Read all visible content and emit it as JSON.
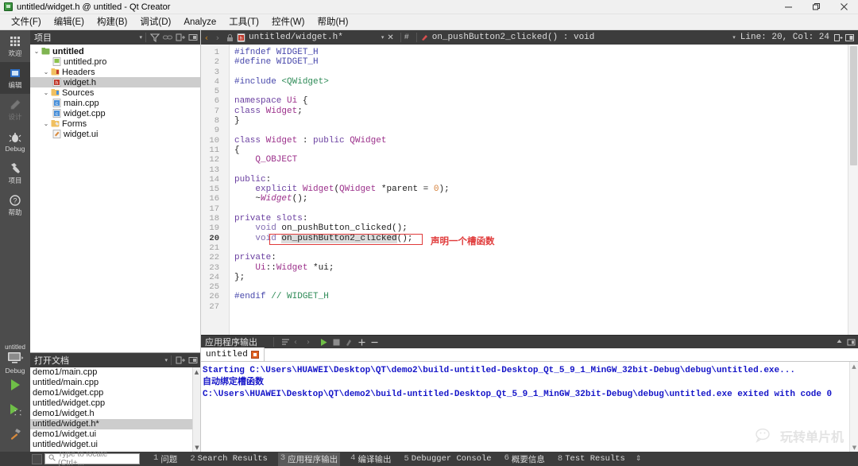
{
  "window": {
    "title": "untitled/widget.h @ untitled - Qt Creator",
    "app_icon": "qt-creator-icon",
    "minimize": "minimize-icon",
    "maximize": "restore-icon",
    "close": "close-icon"
  },
  "menubar": {
    "items": [
      {
        "label": "文件(F)"
      },
      {
        "label": "编辑(E)"
      },
      {
        "label": "构建(B)"
      },
      {
        "label": "调试(D)"
      },
      {
        "label": "Analyze"
      },
      {
        "label": "工具(T)"
      },
      {
        "label": "控件(W)"
      },
      {
        "label": "帮助(H)"
      }
    ]
  },
  "modebar": {
    "items": [
      {
        "label": "欢迎",
        "icon": "grid-icon",
        "state": "normal"
      },
      {
        "label": "编辑",
        "icon": "editor-icon",
        "state": "active"
      },
      {
        "label": "设计",
        "icon": "pencil-icon",
        "state": "disabled"
      },
      {
        "label": "Debug",
        "icon": "bug-icon",
        "state": "normal"
      },
      {
        "label": "项目",
        "icon": "wrench-icon",
        "state": "normal"
      },
      {
        "label": "帮助",
        "icon": "question-icon",
        "state": "normal"
      }
    ],
    "kit": {
      "project": "untitled",
      "build_config": "Debug",
      "selector_icon": "desktop-icon",
      "run_icon": "run-triangle-icon",
      "debug_icon": "debug-run-icon",
      "build_icon": "hammer-icon"
    }
  },
  "project_panel": {
    "title": "项目",
    "header_icons": [
      "filter-icon",
      "link-icon",
      "expand-all-icon",
      "split-icon"
    ],
    "tree": [
      {
        "depth": 0,
        "arrow": "open",
        "icon": "project-icon",
        "label": "untitled",
        "bold": true,
        "selected": false
      },
      {
        "depth": 1,
        "arrow": "none",
        "icon": "pro-file-icon",
        "label": "untitled.pro",
        "bold": false,
        "selected": false
      },
      {
        "depth": 1,
        "arrow": "open",
        "icon": "headers-folder-icon",
        "label": "Headers",
        "bold": false,
        "selected": false
      },
      {
        "depth": 2,
        "arrow": "none",
        "icon": "header-file-icon",
        "label": "widget.h",
        "bold": false,
        "selected": true
      },
      {
        "depth": 1,
        "arrow": "open",
        "icon": "sources-folder-icon",
        "label": "Sources",
        "bold": false,
        "selected": false
      },
      {
        "depth": 2,
        "arrow": "none",
        "icon": "cpp-file-icon",
        "label": "main.cpp",
        "bold": false,
        "selected": false
      },
      {
        "depth": 2,
        "arrow": "none",
        "icon": "cpp-file-icon",
        "label": "widget.cpp",
        "bold": false,
        "selected": false
      },
      {
        "depth": 1,
        "arrow": "open",
        "icon": "forms-folder-icon",
        "label": "Forms",
        "bold": false,
        "selected": false
      },
      {
        "depth": 2,
        "arrow": "none",
        "icon": "ui-file-icon",
        "label": "widget.ui",
        "bold": false,
        "selected": false
      }
    ]
  },
  "open_documents": {
    "title": "打开文档",
    "header_icons": [
      "dropdown-icon",
      "expand-icon",
      "split-icon"
    ],
    "items": [
      {
        "label": "demo1/main.cpp",
        "selected": false
      },
      {
        "label": "untitled/main.cpp",
        "selected": false
      },
      {
        "label": "demo1/widget.cpp",
        "selected": false
      },
      {
        "label": "untitled/widget.cpp",
        "selected": false
      },
      {
        "label": "demo1/widget.h",
        "selected": false
      },
      {
        "label": "untitled/widget.h*",
        "selected": true
      },
      {
        "label": "demo1/widget.ui",
        "selected": false
      },
      {
        "label": "untitled/widget.ui",
        "selected": false
      }
    ]
  },
  "editor_toolbar": {
    "back_icon": "back-chevron-icon",
    "forward_icon": "forward-chevron-icon",
    "lock_icon": "lock-icon",
    "file_icon": "header-file-icon",
    "file_label": "untitled/widget.h*",
    "file_dropdown": "dropdown-icon",
    "close_label": "✕",
    "split_toggle": "hash-icon",
    "symbol_icon": "slot-symbol-icon",
    "symbol_label": "on_pushButton2_clicked() : void",
    "cursor_dropdown": "dropdown-icon",
    "cursor_position": "Line: 20, Col: 24",
    "split_icon": "split-horizontal-icon",
    "unsplit_icon": "unsplit-icon"
  },
  "editor": {
    "cursor_line": 20,
    "total_lines": 27,
    "lines": [
      {
        "n": 1,
        "fold": "",
        "change": "",
        "tokens": [
          {
            "t": "#ifndef WIDGET_H",
            "c": "pre"
          }
        ]
      },
      {
        "n": 2,
        "fold": "",
        "change": "",
        "tokens": [
          {
            "t": "#define WIDGET_H",
            "c": "pre"
          }
        ]
      },
      {
        "n": 3,
        "fold": "",
        "change": "",
        "tokens": []
      },
      {
        "n": 4,
        "fold": "",
        "change": "",
        "tokens": [
          {
            "t": "#include ",
            "c": "pre"
          },
          {
            "t": "<QWidget>",
            "c": "str"
          }
        ]
      },
      {
        "n": 5,
        "fold": "",
        "change": "",
        "tokens": []
      },
      {
        "n": 6,
        "fold": "v",
        "change": "",
        "tokens": [
          {
            "t": "namespace ",
            "c": "kw"
          },
          {
            "t": "Ui",
            "c": "typ"
          },
          {
            "t": " {",
            "c": "fn"
          }
        ]
      },
      {
        "n": 7,
        "fold": "",
        "change": "",
        "tokens": [
          {
            "t": "class ",
            "c": "kw"
          },
          {
            "t": "Widget",
            "c": "typ"
          },
          {
            "t": ";",
            "c": "fn"
          }
        ]
      },
      {
        "n": 8,
        "fold": "",
        "change": "",
        "tokens": [
          {
            "t": "}",
            "c": "fn"
          }
        ]
      },
      {
        "n": 9,
        "fold": "",
        "change": "",
        "tokens": []
      },
      {
        "n": 10,
        "fold": "v",
        "change": "",
        "tokens": [
          {
            "t": "class ",
            "c": "kw"
          },
          {
            "t": "Widget",
            "c": "typ"
          },
          {
            "t": " : ",
            "c": "fn"
          },
          {
            "t": "public ",
            "c": "kw"
          },
          {
            "t": "QWidget",
            "c": "typ"
          }
        ]
      },
      {
        "n": 11,
        "fold": "",
        "change": "",
        "tokens": [
          {
            "t": "{",
            "c": "fn"
          }
        ]
      },
      {
        "n": 12,
        "fold": "",
        "change": "",
        "tokens": [
          {
            "t": "    Q_OBJECT",
            "c": "typ"
          }
        ]
      },
      {
        "n": 13,
        "fold": "",
        "change": "",
        "tokens": []
      },
      {
        "n": 14,
        "fold": "",
        "change": "",
        "tokens": [
          {
            "t": "public",
            "c": "kw"
          },
          {
            "t": ":",
            "c": "fn"
          }
        ]
      },
      {
        "n": 15,
        "fold": "",
        "change": "",
        "tokens": [
          {
            "t": "    explicit ",
            "c": "kw"
          },
          {
            "t": "Widget",
            "c": "typ"
          },
          {
            "t": "(",
            "c": "fn"
          },
          {
            "t": "QWidget",
            "c": "typ"
          },
          {
            "t": " *parent = ",
            "c": "fn"
          },
          {
            "t": "0",
            "c": "num"
          },
          {
            "t": ");",
            "c": "fn"
          }
        ]
      },
      {
        "n": 16,
        "fold": "",
        "change": "",
        "tokens": [
          {
            "t": "    ~",
            "c": "fn"
          },
          {
            "t": "Widget",
            "c": "typ italic"
          },
          {
            "t": "();",
            "c": "fn"
          }
        ]
      },
      {
        "n": 17,
        "fold": "",
        "change": "",
        "tokens": []
      },
      {
        "n": 18,
        "fold": "",
        "change": "green",
        "tokens": [
          {
            "t": "private slots",
            "c": "kw"
          },
          {
            "t": ":",
            "c": "fn"
          }
        ]
      },
      {
        "n": 19,
        "fold": "",
        "change": "green",
        "tokens": [
          {
            "t": "    void ",
            "c": "kw2"
          },
          {
            "t": "on_pushButton_clicked",
            "c": "fn"
          },
          {
            "t": "();",
            "c": "fn"
          }
        ]
      },
      {
        "n": 20,
        "fold": "",
        "change": "red",
        "tokens": [
          {
            "t": "    void ",
            "c": "kw2"
          },
          {
            "t": "on_pushButton2_clicked",
            "c": "fn"
          },
          {
            "t": "();",
            "c": "fn"
          }
        ]
      },
      {
        "n": 21,
        "fold": "",
        "change": "green",
        "tokens": []
      },
      {
        "n": 22,
        "fold": "",
        "change": "green",
        "tokens": [
          {
            "t": "private",
            "c": "kw"
          },
          {
            "t": ":",
            "c": "fn"
          }
        ]
      },
      {
        "n": 23,
        "fold": "",
        "change": "",
        "tokens": [
          {
            "t": "    Ui",
            "c": "typ"
          },
          {
            "t": "::",
            "c": "fn"
          },
          {
            "t": "Widget",
            "c": "typ"
          },
          {
            "t": " *ui;",
            "c": "fn"
          }
        ]
      },
      {
        "n": 24,
        "fold": "",
        "change": "",
        "tokens": [
          {
            "t": "};",
            "c": "fn"
          }
        ]
      },
      {
        "n": 25,
        "fold": "",
        "change": "",
        "tokens": []
      },
      {
        "n": 26,
        "fold": "",
        "change": "",
        "tokens": [
          {
            "t": "#endif ",
            "c": "pre"
          },
          {
            "t": "// WIDGET_H",
            "c": "cmt"
          }
        ]
      },
      {
        "n": 27,
        "fold": "",
        "change": "",
        "tokens": []
      }
    ],
    "annotation": {
      "text": "声明一个槽函数",
      "color": "#e03b3b",
      "target_line": 20
    }
  },
  "output_pane": {
    "title": "应用程序输出",
    "toolbar_icons": [
      "word-wrap-icon",
      "prev-icon",
      "next-icon",
      "run-icon",
      "stop-icon",
      "attach-icon",
      "zoom-in-icon",
      "zoom-out-icon"
    ],
    "right_icons": [
      "maximize-pane-icon",
      "close-pane-icon"
    ],
    "tab": {
      "label": "untitled",
      "stop_icon": "stop-square-icon"
    },
    "lines": [
      "Starting C:\\Users\\HUAWEI\\Desktop\\QT\\demo2\\build-untitled-Desktop_Qt_5_9_1_MinGW_32bit-Debug\\debug\\untitled.exe...",
      "自动绑定槽函数",
      "C:\\Users\\HUAWEI\\Desktop\\QT\\demo2\\build-untitled-Desktop_Qt_5_9_1_MinGW_32bit-Debug\\debug\\untitled.exe exited with code 0"
    ],
    "watermark": {
      "text": "玩转单片机",
      "icon": "wechat-icon"
    }
  },
  "statusbar": {
    "grip_icon": "sidebar-toggle-icon",
    "locator": {
      "icon": "search-icon",
      "placeholder": "Type to locate (Ctrl+...",
      "value": ""
    },
    "items": [
      {
        "num": "1",
        "label": "问题",
        "active": false
      },
      {
        "num": "2",
        "label": "Search Results",
        "active": false
      },
      {
        "num": "3",
        "label": "应用程序输出",
        "active": true
      },
      {
        "num": "4",
        "label": "编译输出",
        "active": false
      },
      {
        "num": "5",
        "label": "Debugger Console",
        "active": false
      },
      {
        "num": "6",
        "label": "概要信息",
        "active": false
      },
      {
        "num": "8",
        "label": "Test Results",
        "active": false
      }
    ],
    "resize_handle": "resize-grip-icon"
  },
  "colors": {
    "accent_orange": "#c8821e",
    "dark_chrome": "#3c3c3c",
    "mode_bar": "#4c4c4c",
    "annotation_red": "#e03b3b",
    "output_blue": "#1414c8",
    "change_green": "#6fbf73"
  }
}
